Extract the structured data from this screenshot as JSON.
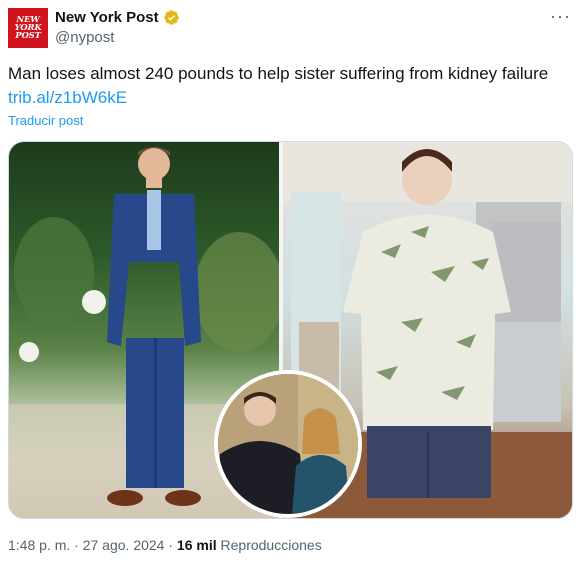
{
  "header": {
    "display_name": "New York Post",
    "handle": "@nypost",
    "avatar_text": [
      "NEW",
      "YORK",
      "POST"
    ],
    "more_label": "···"
  },
  "tweet": {
    "text": "Man loses almost 240 pounds to help sister suffering from kidney failure",
    "link": "trib.al/z1bW6kE",
    "translate_label": "Traducir post"
  },
  "meta": {
    "time": "1:48 p. m.",
    "date": "27 ago. 2024",
    "views_count": "16 mil",
    "views_label": "Reproducciones",
    "separator": "·"
  },
  "colors": {
    "brand": "#d0141e",
    "link": "#1d9bf0",
    "verified_badge": "#e2b719",
    "secondary_text": "#536471"
  },
  "icons": {
    "verified": "verified-gold-badge-icon",
    "more": "more-horizontal-icon"
  }
}
